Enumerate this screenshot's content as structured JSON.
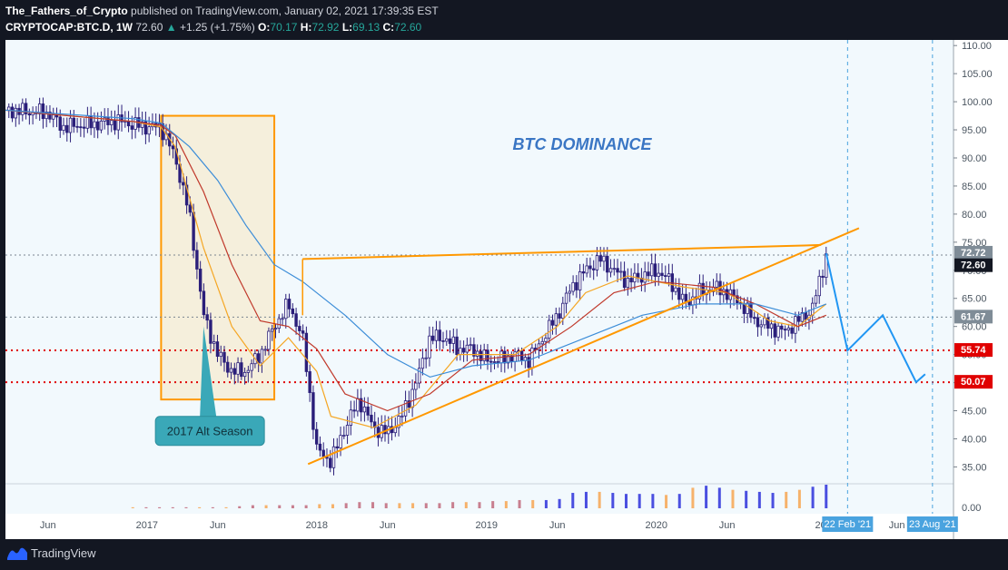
{
  "header": {
    "author": "The_Fathers_of_Crypto",
    "published_text": "published on TradingView.com, January 02, 2021 17:39:35 EST",
    "symbol": "CRYPTOCAP:BTC.D, 1W",
    "last": "72.60",
    "change": "+1.25 (+1.75%)",
    "o_label": "O:",
    "o_value": "70.17",
    "h_label": "H:",
    "h_value": "72.92",
    "l_label": "L:",
    "l_value": "69.13",
    "c_label": "C:",
    "c_value": "72.60"
  },
  "footer": {
    "brand": "TradingView"
  },
  "colors": {
    "background": "#f2f9fd",
    "up": "#26a69a",
    "candle": "#2b1f7a",
    "ma_fast": "#f5a623",
    "ma_mid": "#c0392b",
    "ma_slow": "#3c8dd8",
    "annotation": "#ff9800",
    "projection": "#2196f3",
    "support": "#e00000"
  },
  "chart_data": {
    "type": "candlestick",
    "title": "BTC DOMINANCE",
    "y_ticks": [
      110,
      105,
      100,
      95,
      90,
      85,
      80,
      75,
      70,
      65,
      60,
      55,
      50,
      45,
      40,
      35
    ],
    "x_ticks": [
      "Jun",
      "2017",
      "Jun",
      "2018",
      "Jun",
      "2019",
      "Jun",
      "2020",
      "Jun",
      "2021",
      "Jun"
    ],
    "ylim": [
      32,
      111
    ],
    "xlim": [
      "2016-03",
      "2021-10"
    ],
    "price_labels": [
      {
        "value": 72.72,
        "text": "72.72",
        "kind": "gray"
      },
      {
        "value": 72.6,
        "text": "72.60",
        "kind": "current"
      },
      {
        "value": 61.67,
        "text": "61.67",
        "kind": "gray"
      },
      {
        "value": 55.74,
        "text": "55.74",
        "kind": "red"
      },
      {
        "value": 50.07,
        "text": "50.07",
        "kind": "red"
      }
    ],
    "volume_axis_label": "0.00",
    "date_labels": [
      "22 Feb '21",
      "23 Aug '21"
    ],
    "annotation_label": "2017 Alt Season",
    "series": [
      {
        "name": "",
        "points": [
          [
            "2016-03",
            98.5
          ],
          [
            "2016-06",
            98
          ],
          [
            "2016-07",
            95.5
          ],
          [
            "2016-09",
            96
          ],
          [
            "2016-11",
            96.5
          ],
          [
            "2017-01",
            95.5
          ],
          [
            "2017-02",
            95.5
          ],
          [
            "2017-03",
            90
          ],
          [
            "2017-04",
            80
          ],
          [
            "2017-05",
            62
          ],
          [
            "2017-06",
            55
          ],
          [
            "2017-07",
            52
          ],
          [
            "2017-08",
            52
          ],
          [
            "2017-09",
            55
          ],
          [
            "2017-10",
            60
          ],
          [
            "2017-11",
            64
          ],
          [
            "2017-12",
            58
          ],
          [
            "2018-01",
            38
          ],
          [
            "2018-02",
            36
          ],
          [
            "2018-03",
            42
          ],
          [
            "2018-04",
            47
          ],
          [
            "2018-05",
            42
          ],
          [
            "2018-06",
            41
          ],
          [
            "2018-07",
            44
          ],
          [
            "2018-08",
            50
          ],
          [
            "2018-09",
            58
          ],
          [
            "2018-10",
            58
          ],
          [
            "2018-11",
            56
          ],
          [
            "2018-12",
            56
          ],
          [
            "2019-01",
            54
          ],
          [
            "2019-02",
            54
          ],
          [
            "2019-03",
            55
          ],
          [
            "2019-04",
            54
          ],
          [
            "2019-05",
            58
          ],
          [
            "2019-06",
            62
          ],
          [
            "2019-07",
            67
          ],
          [
            "2019-08",
            70
          ],
          [
            "2019-09",
            72
          ],
          [
            "2019-10",
            70
          ],
          [
            "2019-11",
            68
          ],
          [
            "2019-12",
            69
          ],
          [
            "2020-01",
            70
          ],
          [
            "2020-02",
            68
          ],
          [
            "2020-03",
            64
          ],
          [
            "2020-04",
            66
          ],
          [
            "2020-05",
            67
          ],
          [
            "2020-06",
            66
          ],
          [
            "2020-07",
            64
          ],
          [
            "2020-08",
            61
          ],
          [
            "2020-09",
            60
          ],
          [
            "2020-10",
            59
          ],
          [
            "2020-11",
            61
          ],
          [
            "2020-12",
            63
          ],
          [
            "2021-01",
            72.6
          ]
        ]
      },
      {
        "name": "",
        "points": [
          [
            "2016-03",
            98.5
          ],
          [
            "2016-12",
            96.5
          ],
          [
            "2017-02",
            95.5
          ],
          [
            "2017-03",
            92
          ],
          [
            "2017-05",
            74
          ],
          [
            "2017-07",
            60
          ],
          [
            "2017-09",
            53
          ],
          [
            "2017-11",
            58
          ],
          [
            "2018-01",
            52
          ],
          [
            "2018-02",
            44
          ],
          [
            "2018-05",
            42
          ],
          [
            "2018-08",
            46
          ],
          [
            "2018-11",
            55
          ],
          [
            "2019-03",
            55
          ],
          [
            "2019-06",
            60
          ],
          [
            "2019-08",
            66
          ],
          [
            "2019-11",
            69
          ],
          [
            "2020-03",
            67
          ],
          [
            "2020-06",
            66
          ],
          [
            "2020-09",
            61
          ],
          [
            "2020-11",
            60
          ],
          [
            "2021-01",
            64
          ]
        ]
      },
      {
        "name": "",
        "points": [
          [
            "2016-03",
            98.5
          ],
          [
            "2016-12",
            96.5
          ],
          [
            "2017-02",
            95.8
          ],
          [
            "2017-03",
            94
          ],
          [
            "2017-05",
            84
          ],
          [
            "2017-07",
            71
          ],
          [
            "2017-09",
            61
          ],
          [
            "2017-11",
            60
          ],
          [
            "2018-01",
            56
          ],
          [
            "2018-03",
            48
          ],
          [
            "2018-06",
            45
          ],
          [
            "2018-09",
            48
          ],
          [
            "2018-12",
            54
          ],
          [
            "2019-04",
            55
          ],
          [
            "2019-07",
            60
          ],
          [
            "2019-10",
            66
          ],
          [
            "2020-01",
            68
          ],
          [
            "2020-05",
            67
          ],
          [
            "2020-08",
            64
          ],
          [
            "2020-11",
            60
          ],
          [
            "2021-01",
            62
          ]
        ]
      },
      {
        "name": "",
        "points": [
          [
            "2016-03",
            98.5
          ],
          [
            "2016-12",
            97
          ],
          [
            "2017-02",
            96.2
          ],
          [
            "2017-04",
            92
          ],
          [
            "2017-06",
            86
          ],
          [
            "2017-08",
            78
          ],
          [
            "2017-10",
            71
          ],
          [
            "2017-12",
            68
          ],
          [
            "2018-03",
            62
          ],
          [
            "2018-06",
            55
          ],
          [
            "2018-09",
            51
          ],
          [
            "2018-12",
            53
          ],
          [
            "2019-04",
            54
          ],
          [
            "2019-08",
            58
          ],
          [
            "2019-12",
            62
          ],
          [
            "2020-04",
            64
          ],
          [
            "2020-08",
            64
          ],
          [
            "2020-11",
            62
          ],
          [
            "2021-01",
            64
          ]
        ]
      }
    ],
    "volume": [
      0.1,
      0.1,
      0.1,
      0.1,
      0.1,
      0.1,
      0.1,
      0.1,
      0.2,
      0.3,
      0.3,
      0.3,
      0.3,
      0.3,
      0.4,
      0.4,
      0.5,
      0.6,
      0.6,
      0.5,
      0.5,
      0.5,
      0.5,
      0.5,
      0.6,
      0.6,
      0.6,
      0.7,
      0.7,
      0.8,
      0.8,
      0.8,
      0.9,
      1.5,
      1.6,
      1.6,
      1.5,
      1.4,
      1.4,
      1.4,
      1.3,
      1.4,
      2.0,
      2.2,
      2.0,
      1.8,
      1.7,
      1.6,
      1.5,
      1.6,
      1.8,
      2.1,
      2.3
    ]
  }
}
